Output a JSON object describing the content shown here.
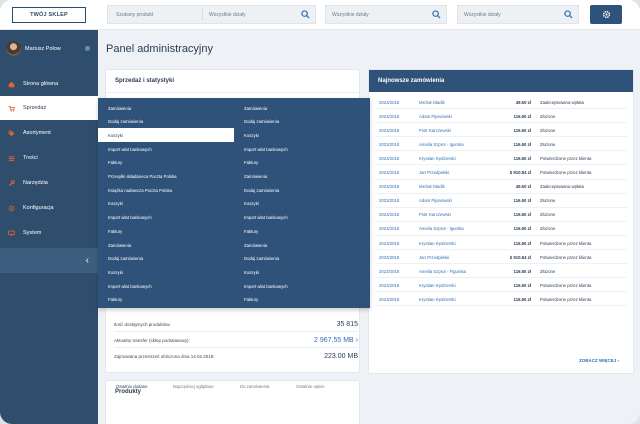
{
  "topbar": {
    "shop_button": "TWÓJ SKLEP",
    "search1_placeholder": "Szukany produkt",
    "search1_category": "Wszystkie działy",
    "search2_category": "Wszystkie działy",
    "search3_category": "Wszystkie działy"
  },
  "sidebar": {
    "user_name": "Mariusz Polow",
    "items": [
      {
        "label": "Strona główna",
        "icon": "home-icon"
      },
      {
        "label": "Sprzedaż",
        "icon": "cart-icon"
      },
      {
        "label": "Asortyment",
        "icon": "tag-icon"
      },
      {
        "label": "Treści",
        "icon": "lines-icon"
      },
      {
        "label": "Narzędzia",
        "icon": "wrench-icon"
      },
      {
        "label": "Konfiguracja",
        "icon": "gear-icon"
      },
      {
        "label": "System",
        "icon": "monitor-icon"
      }
    ],
    "collapse_glyph": "‹"
  },
  "main": {
    "title": "Panel administracyjny",
    "sales_card": {
      "title": "Sprzedaż i statystyki",
      "stats": [
        {
          "label": "Ilość dostępnych produktów:",
          "value": "35 815"
        },
        {
          "label": "Aktualny transfer (sklep podstawowy):",
          "value": "2 967.55 MB"
        },
        {
          "label": "Zajmowana przestrzeń obliczona dnia 14.02.2018:",
          "value": "223.00 MB"
        }
      ]
    },
    "mega_menu": {
      "col1": [
        "Zamówienia",
        "Dodaj zamówienia",
        "Koszyki",
        "Import wlat bankowych",
        "Faktury",
        "Przesyłki składaneca Poczta Polska",
        "Książka nadawcza Poczta Polska",
        "Koszyki",
        "Import wlat bankowych",
        "Faktury",
        "Zamówienia",
        "Dodaj zamówienia",
        "Koszyki",
        "Import wlat bankowych",
        "Faktury"
      ],
      "col2": [
        "Zamówienia",
        "Dodaj zamówienia",
        "Koszyki",
        "Import wlat bankowych",
        "Faktury",
        "Zamówienia",
        "Dodaj zamówienia",
        "Koszyki",
        "Import wlat bankowych",
        "Faktury",
        "Zamówienia",
        "Dodaj zamówienia",
        "Koszyki",
        "Import wlat bankowych",
        "Faktury"
      ],
      "active_index": 2
    },
    "orders": {
      "title": "Najnowsze zamówienia",
      "rows": [
        [
          "2023/2018",
          "Michał Gładik",
          "49.50 zł",
          "Zaakceptowana wpłata"
        ],
        [
          "2023/2018",
          "Adam Pijanowski",
          "116.50 zł",
          "Złożone"
        ],
        [
          "2023/2018",
          "Piotr Karczewski",
          "116.50 zł",
          "Złożone"
        ],
        [
          "2023/2018",
          "Amelia Szprot - Igurska",
          "116.50 zł",
          "Złożone"
        ],
        [
          "2023/2018",
          "Krystian Kędzierski",
          "116.50 zł",
          "Potwierdzone przez klienta"
        ],
        [
          "2023/2018",
          "Jan Przedpełski",
          "$ 910.84 zł",
          "Potwierdzone przez klienta"
        ],
        [
          "2023/2018",
          "Michał Gładik",
          "49.50 zł",
          "Zaakceptowana wpłata"
        ],
        [
          "2023/2018",
          "Adam Pijanowski",
          "116.50 zł",
          "Złożone"
        ],
        [
          "2023/2018",
          "Piotr Karczewski",
          "116.50 zł",
          "Złożone"
        ],
        [
          "2023/2018",
          "Amelia Szprot - Igurska",
          "116.50 zł",
          "Złożone"
        ],
        [
          "2023/2018",
          "Krystian Kędzierski",
          "116.50 zł",
          "Potwierdzone przez klienta"
        ],
        [
          "2023/2018",
          "Jan Przedpełski",
          "$ 910.84 zł",
          "Potwierdzone przez klienta"
        ],
        [
          "2023/2018",
          "Amelia Szprot - Figurska",
          "116.50 zł",
          "Złożone"
        ],
        [
          "2023/2018",
          "Krystian Kędzierski",
          "116.50 zł",
          "Potwierdzone przez klienta"
        ],
        [
          "2023/2018",
          "Krystian Kędzierski",
          "116.50 zł",
          "Potwierdzone przez klienta"
        ]
      ],
      "see_more": "ZOBACZ WIĘCEJ"
    },
    "products_card": {
      "title": "Produkty",
      "tabs": [
        "Ostatnio dodane",
        "Najczęściej oglądane",
        "Do zamówienia",
        "Ostatnie opinie"
      ]
    }
  },
  "colors": {
    "sidebar": "#2f4e6e",
    "accent": "#2f527b",
    "active_icon": "#e4622e",
    "link": "#2f6fb5"
  }
}
